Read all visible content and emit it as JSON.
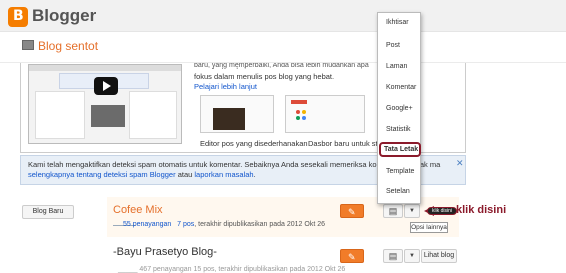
{
  "app": {
    "brand": "Blogger",
    "logo_letter": "B"
  },
  "blog": {
    "title": "Blog sentot"
  },
  "intro": {
    "partial_top": "baru, yang memperbaiki, Anda bisa lebih mudahkan apa yang Anda sukai",
    "body": "fokus dalam menulis pos blog yang hebat.",
    "link": "Pelajari lebih lanjut",
    "caption_editor": "Editor pos yang disederhanakan",
    "caption_dashboard": "Dasbor baru untuk statisti"
  },
  "spam_notice": {
    "line1": "Kami telah mengaktifkan deteksi spam otomatis untuk komentar. Sebaiknya Anda sesekali memeriksa komentar di kotak ma",
    "link1": "selengkapnya tentang deteksi spam Blogger",
    "mid": " atau ",
    "link2": "laporkan masalah",
    "end": ".",
    "close": "✕"
  },
  "new_post_label": "Blog Baru",
  "posts": [
    {
      "title": "Cofee Mix",
      "views": "55 penayangan",
      "posts": "7 pos",
      "published": ", terakhir dipublikasikan pada 2012 Okt 26"
    },
    {
      "title": "-Bayu Prasetyo Blog-",
      "meta": "_____ 467 penayangan   15 pos, terakhir dipublikasikan pada 2012 Okt 26",
      "view_label": "Lihat blog"
    }
  ],
  "tooltip": "Opsi lainnya",
  "annotation": {
    "text": "klik disini",
    "pill": "klik disini"
  },
  "menu": {
    "items": [
      "Ikhtisar",
      "Post",
      "Laman",
      "Komentar",
      "Google+",
      "Statistik",
      "Tata Letak",
      "Template",
      "Setelan"
    ],
    "highlighted": "Tata Letak"
  },
  "colors": {
    "accent": "#f17c29",
    "brand_orange": "#f57d00",
    "annotation": "#8b1a2b",
    "link": "#1155cc"
  },
  "icons": {
    "edit": "pencil-icon",
    "copy": "copy-icon",
    "dropdown": "chevron-down-icon",
    "play": "play-icon",
    "close": "close-icon"
  }
}
